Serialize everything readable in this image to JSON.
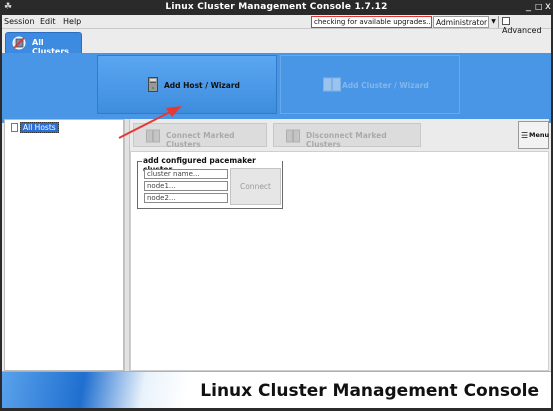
{
  "window": {
    "title": "Linux Cluster Management Console 1.7.12",
    "minimize_glyph": "_",
    "maximize_glyph": "□",
    "close_glyph": "x"
  },
  "menubar": {
    "session": "Session",
    "edit": "Edit",
    "help": "Help",
    "status_text": "checking for available upgrades...",
    "user": "Administrator",
    "advanced_label": "Advanced",
    "advanced_checked": false
  },
  "tabs": [
    {
      "label": "All Clusters",
      "icon": "cluster-icon"
    }
  ],
  "actions": {
    "add_host": "Add Host / Wizard",
    "add_cluster": "Add Cluster / Wizard"
  },
  "tree": {
    "root": "All Hosts"
  },
  "toolbar": {
    "connect_marked": "Connect Marked Clusters",
    "disconnect_marked": "Disconnect Marked Clusters",
    "menu": "Menu"
  },
  "add_cluster_form": {
    "legend": "add configured pacemaker cluster",
    "cluster_name_placeholder": "cluster name...",
    "node1_placeholder": "node1...",
    "node2_placeholder": "node2...",
    "connect_label": "Connect"
  },
  "footer": {
    "title": "Linux Cluster Management Console"
  },
  "colors": {
    "accent_blue": "#4a96e6",
    "annotation_arrow": "#e53935",
    "status_border": "#dd3333"
  }
}
